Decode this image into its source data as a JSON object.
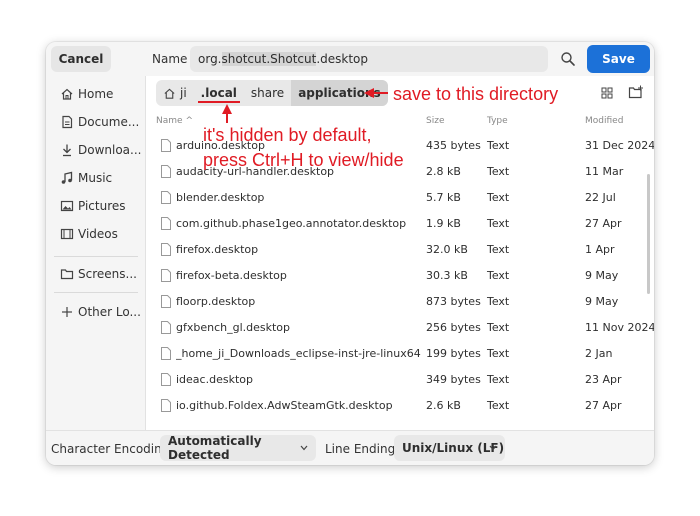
{
  "header": {
    "cancel_label": "Cancel",
    "name_label": "Name",
    "filename_prefix": "org.",
    "filename_selected": "shotcut.Shotcut",
    "filename_suffix": ".desktop",
    "save_label": "Save"
  },
  "sidebar": {
    "items": [
      {
        "label": "Home",
        "icon": "home-icon"
      },
      {
        "label": "Docume...",
        "icon": "document-icon"
      },
      {
        "label": "Downloa...",
        "icon": "download-icon"
      },
      {
        "label": "Music",
        "icon": "music-icon"
      },
      {
        "label": "Pictures",
        "icon": "picture-icon"
      },
      {
        "label": "Videos",
        "icon": "video-icon"
      },
      {
        "label": "Screens...",
        "icon": "folder-icon"
      },
      {
        "label": "Other Lo...",
        "icon": "plus-icon"
      }
    ]
  },
  "pathbar": {
    "crumbs": [
      "ji",
      ".local",
      "share",
      "applications"
    ]
  },
  "columns": {
    "name": "Name",
    "size": "Size",
    "type": "Type",
    "modified": "Modified"
  },
  "files": [
    {
      "name": "arduino.desktop",
      "size": "435 bytes",
      "type": "Text",
      "modified": "31 Dec 2024"
    },
    {
      "name": "audacity-url-handler.desktop",
      "size": "2.8 kB",
      "type": "Text",
      "modified": "11 Mar"
    },
    {
      "name": "blender.desktop",
      "size": "5.7 kB",
      "type": "Text",
      "modified": "22 Jul"
    },
    {
      "name": "com.github.phase1geo.annotator.desktop",
      "size": "1.9 kB",
      "type": "Text",
      "modified": "27 Apr"
    },
    {
      "name": "firefox.desktop",
      "size": "32.0 kB",
      "type": "Text",
      "modified": "1 Apr"
    },
    {
      "name": "firefox-beta.desktop",
      "size": "30.3 kB",
      "type": "Text",
      "modified": "9 May"
    },
    {
      "name": "floorp.desktop",
      "size": "873 bytes",
      "type": "Text",
      "modified": "9 May"
    },
    {
      "name": "gfxbench_gl.desktop",
      "size": "256 bytes",
      "type": "Text",
      "modified": "11 Nov 2024"
    },
    {
      "name": "_home_ji_Downloads_eclipse-inst-jre-linux64.",
      "size": "199 bytes",
      "type": "Text",
      "modified": "2 Jan"
    },
    {
      "name": "ideac.desktop",
      "size": "349 bytes",
      "type": "Text",
      "modified": "23 Apr"
    },
    {
      "name": "io.github.Foldex.AdwSteamGtk.desktop",
      "size": "2.6 kB",
      "type": "Text",
      "modified": "27 Apr"
    }
  ],
  "footer": {
    "encoding_label": "Character Encoding:",
    "encoding_value": "Automatically Detected",
    "line_ending_label": "Line Ending:",
    "line_ending_value": "Unix/Linux (LF)"
  },
  "annotations": {
    "save_note": "save to this directory",
    "hidden_note_1": "it's hidden by default,",
    "hidden_note_2": "press Ctrl+H to view/hide"
  },
  "colors": {
    "accent": "#1c71d8",
    "annotation": "#e01b24"
  }
}
